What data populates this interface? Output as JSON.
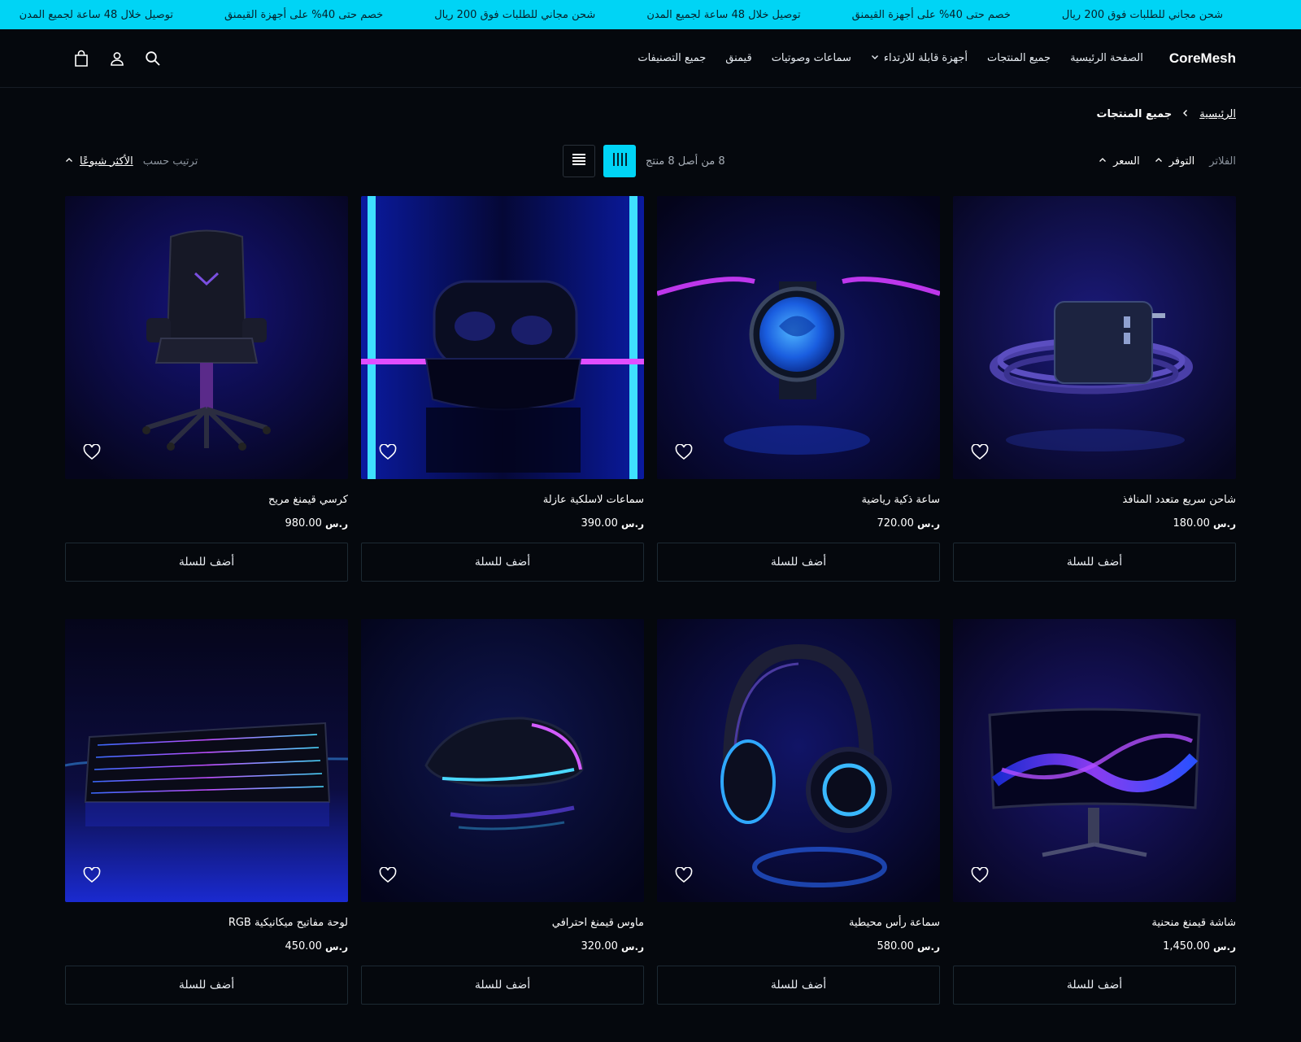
{
  "announcement": {
    "items": [
      "شحن مجاني للطلبات فوق 200 ريال",
      "خصم حتى 40% على أجهزة القيمنق",
      "توصيل خلال 48 ساعة لجميع المدن",
      "شحن مجاني للطلبات فوق 200 ريال",
      "خصم حتى 40% على أجهزة القيمنق",
      "توصيل خلال 48 ساعة لجميع المدن"
    ],
    "background": "#00d4f5"
  },
  "header": {
    "logo": "CoreMesh",
    "nav": [
      {
        "label": "الصفحة الرئيسية"
      },
      {
        "label": "جميع المنتجات"
      },
      {
        "label": "أجهزة قابلة للارتداء",
        "has_dropdown": true
      },
      {
        "label": "سماعات وصوتيات"
      },
      {
        "label": "قيمنق"
      },
      {
        "label": "جميع التصنيفات"
      }
    ],
    "icons": [
      "search-icon",
      "user-icon",
      "cart-icon"
    ]
  },
  "breadcrumb": {
    "home": "الرئيسية",
    "current": "جميع المنتجات"
  },
  "toolbar": {
    "filters_label": "الفلاتر",
    "availability": "التوفر",
    "price": "السعر",
    "count_text": "8 من أصل 8 منتج",
    "sort_label": "ترتيب حسب",
    "sort_value": "الأكثر شيوعًا"
  },
  "accent_color": "#00d4f5",
  "currency_symbol": "ر.س",
  "products": [
    {
      "name": "شاحن سريع متعدد المنافذ",
      "price": "180.00",
      "button": "أضف للسلة",
      "image": "charger"
    },
    {
      "name": "ساعة ذكية رياضية",
      "price": "720.00",
      "button": "أضف للسلة",
      "image": "watch"
    },
    {
      "name": "سماعات لاسلكية عازلة",
      "price": "390.00",
      "button": "أضف للسلة",
      "image": "earbuds"
    },
    {
      "name": "كرسي قيمنغ مريح",
      "price": "980.00",
      "button": "أضف للسلة",
      "image": "chair"
    },
    {
      "name": "شاشة قيمنغ منحنية",
      "price": "1,450.00",
      "button": "أضف للسلة",
      "image": "monitor"
    },
    {
      "name": "سماعة رأس محيطية",
      "price": "580.00",
      "button": "أضف للسلة",
      "image": "headphones"
    },
    {
      "name": "ماوس قيمنغ احترافي",
      "price": "320.00",
      "button": "أضف للسلة",
      "image": "mouse"
    },
    {
      "name": "لوحة مفاتيح ميكانيكية RGB",
      "price": "450.00",
      "button": "أضف للسلة",
      "image": "keyboard"
    }
  ]
}
